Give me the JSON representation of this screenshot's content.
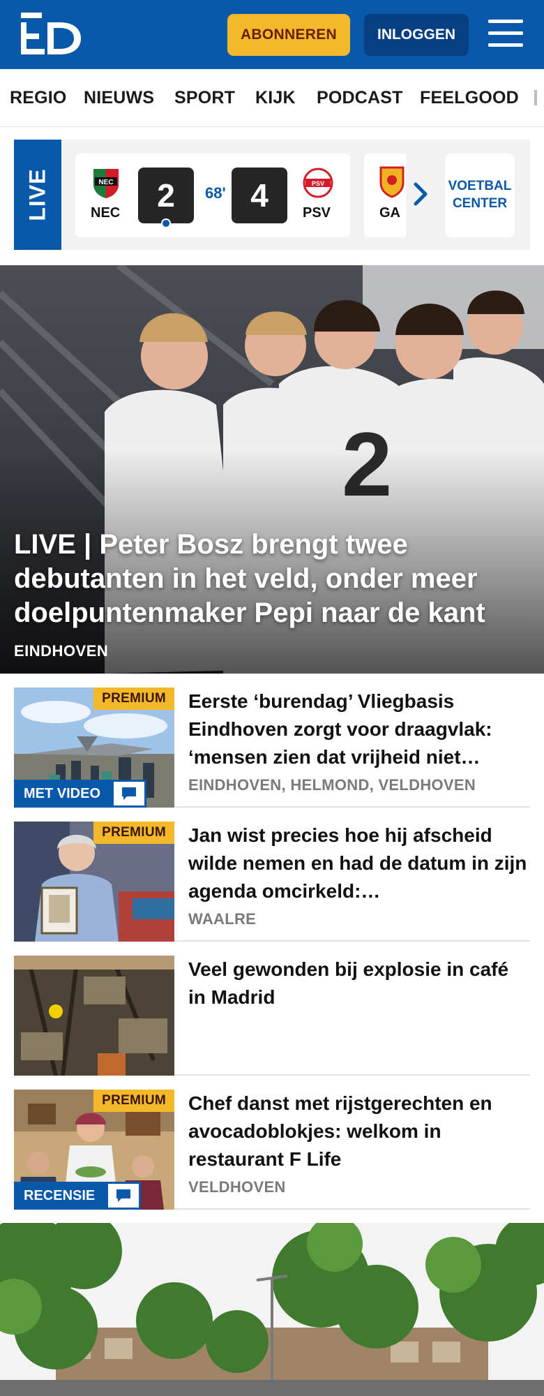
{
  "header": {
    "logo_text": "ED",
    "subscribe_label": "ABONNEREN",
    "login_label": "INLOGGEN",
    "menu_icon": "hamburger-icon",
    "brand_color": "#0a58aa",
    "accent_color": "#f4b92b"
  },
  "nav": {
    "items": [
      "REGIO",
      "NIEUWS",
      "SPORT",
      "KIJK",
      "PODCAST",
      "FEELGOOD"
    ]
  },
  "scores": {
    "live_label": "LIVE",
    "match": {
      "home": "NEC",
      "home_score": "2",
      "minute": "68'",
      "away_score": "4",
      "away": "PSV"
    },
    "next_team": "GA",
    "voetbal_center_label": "VOETBAL CENTER"
  },
  "hero": {
    "prefix": "LIVE",
    "separator": "|",
    "title": "Peter Bosz brengt twee debutanten in het veld, onder meer doelpuntenmaker Pepi naar de kant",
    "location": "EINDHOVEN"
  },
  "articles": [
    {
      "badge": "PREMIUM",
      "tag": "MET VIDEO",
      "title": "Eerste ‘burendag’ Vliegbasis Eindhoven zorgt voor draagvlak: ‘mensen zien dat vrijheid niet…",
      "location": "EINDHOVEN, HELMOND, VELDHOVEN"
    },
    {
      "badge": "PREMIUM",
      "tag": "",
      "title": "Jan wist precies hoe hij afscheid wilde nemen en had de datum in zijn agenda omcirkeld:…",
      "location": "WAALRE"
    },
    {
      "badge": "",
      "tag": "",
      "title": "Veel gewonden bij explosie in café in Madrid",
      "location": ""
    },
    {
      "badge": "PREMIUM",
      "tag": "RECENSIE",
      "title": "Chef danst met rijstgerechten en avocadoblokjes: welkom in restaurant F Life",
      "location": "VELDHOVEN"
    }
  ]
}
